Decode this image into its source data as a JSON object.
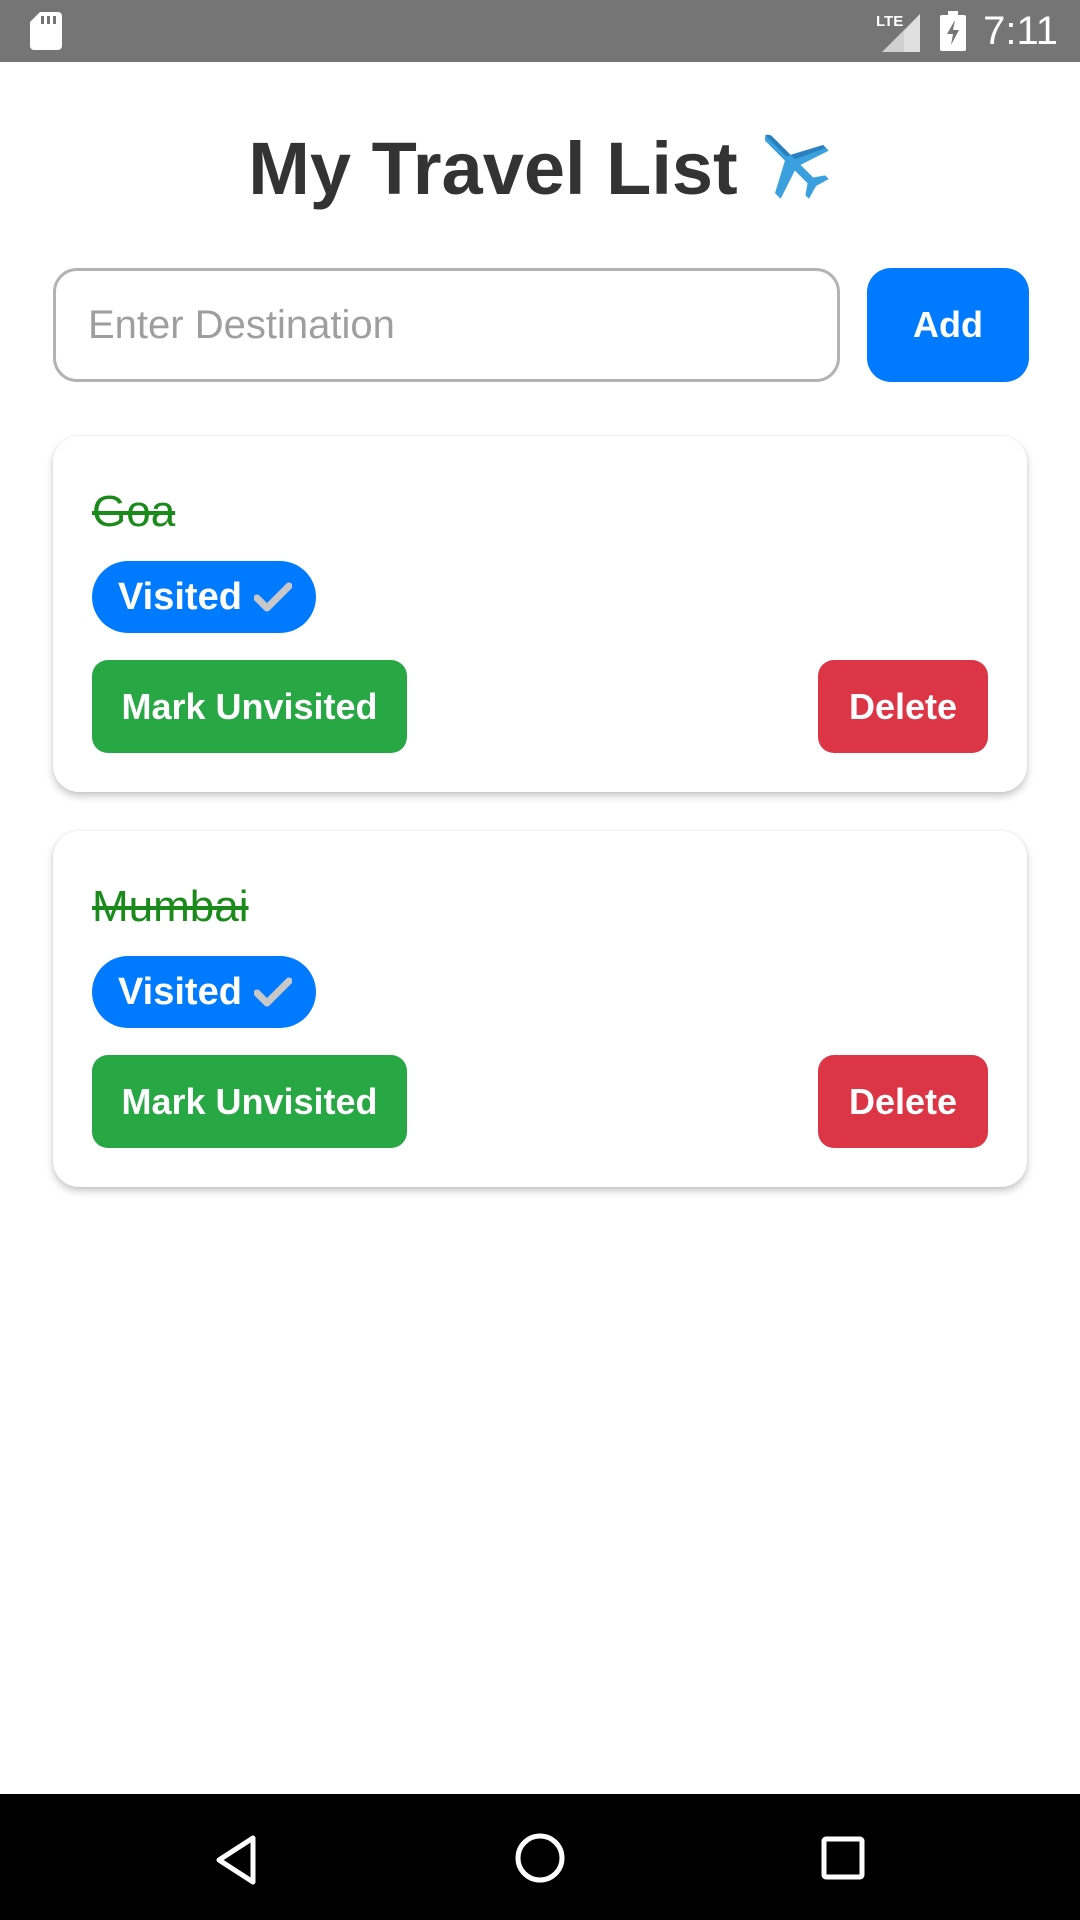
{
  "status_bar": {
    "time": "7:11",
    "network_label": "LTE",
    "icons": [
      "sd-card-icon",
      "signal-icon",
      "battery-charging-icon"
    ]
  },
  "header": {
    "title": "My Travel List",
    "title_icon": "airplane-icon"
  },
  "form": {
    "placeholder": "Enter Destination",
    "value": "",
    "add_label": "Add"
  },
  "destinations": [
    {
      "name": "Goa",
      "badge_label": "Visited",
      "badge_icon": "check-icon",
      "toggle_label": "Mark Unvisited",
      "delete_label": "Delete",
      "visited": true
    },
    {
      "name": "Mumbai",
      "badge_label": "Visited",
      "badge_icon": "check-icon",
      "toggle_label": "Mark Unvisited",
      "delete_label": "Delete",
      "visited": true
    }
  ],
  "colors": {
    "primary": "#007bff",
    "success": "#28a745",
    "danger": "#dc3545",
    "visited_text": "#1a8a1a",
    "title_text": "#333333"
  },
  "nav_bar": {
    "icons": [
      "back-icon",
      "home-icon",
      "recents-icon"
    ]
  }
}
